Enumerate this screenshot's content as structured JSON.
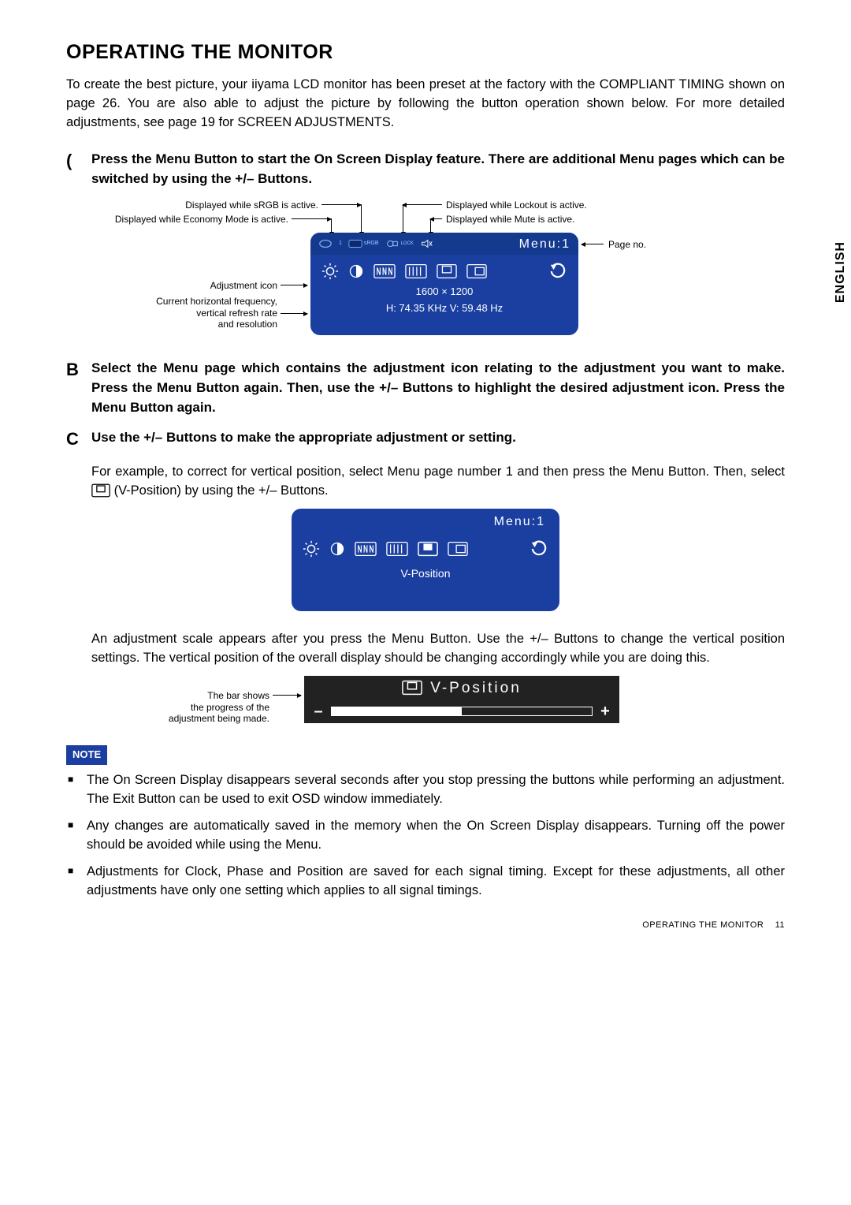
{
  "title": "OPERATING THE MONITOR",
  "intro": "To create the best picture, your iiyama LCD monitor has been preset at the factory with the COMPLIANT TIMING shown on page 26. You are also able to adjust the picture by following the button operation shown below. For more detailed adjustments, see page 19 for SCREEN ADJUSTMENTS.",
  "language_tab": "ENGLISH",
  "step_a": {
    "marker": "(",
    "text": "Press the Menu Button to start the On Screen Display feature. There are additional Menu pages which can be switched by using the +/– Buttons."
  },
  "diagram1": {
    "callouts": {
      "srgb": "Displayed while sRGB is active.",
      "economy": "Displayed while Economy Mode is active.",
      "lockout": "Displayed while Lockout is active.",
      "mute": "Displayed while Mute is active.",
      "pageno": "Page no.",
      "adj_icon": "Adjustment icon",
      "freq_line1": "Current horizontal frequency,",
      "freq_line2": "vertical refresh rate",
      "freq_line3": "and resolution"
    },
    "osd": {
      "menu_label": "Menu:1",
      "srgb_badge": "sRGB",
      "lock_badge": "LOCK",
      "economy_badge": "1",
      "resolution": "1600 × 1200",
      "frequency": "H: 74.35 KHz  V: 59.48 Hz"
    }
  },
  "step_b": {
    "marker": "B",
    "text": "Select the Menu page which contains the adjustment icon relating to the adjustment you want to make. Press the Menu Button again. Then, use the +/– Buttons to highlight the desired adjustment icon. Press the Menu Button again."
  },
  "step_c": {
    "marker": "C",
    "text": "Use the +/– Buttons to make the appropriate adjustment or setting.",
    "body_pre": "For example, to correct for vertical position, select Menu page number 1 and then press the Menu Button. Then, select ",
    "body_post": " (V-Position) by using the +/– Buttons."
  },
  "osd2": {
    "menu_label": "Menu:1",
    "selected_label": "V-Position"
  },
  "after_osd2": "An adjustment scale appears after you press the Menu Button. Use the +/– Buttons to change the vertical position settings. The vertical position of the overall display should be changing accordingly while you are doing this.",
  "adjbar": {
    "title": "V-Position",
    "minus": "–",
    "plus": "+",
    "callout_line1": "The bar shows",
    "callout_line2": "the progress of the",
    "callout_line3": "adjustment being made."
  },
  "note_label": "NOTE",
  "notes": [
    "The On Screen Display disappears several seconds after you stop pressing the buttons while performing an adjustment. The Exit Button can be used to exit OSD window immediately.",
    "Any changes are automatically saved in the memory when the On Screen Display disappears. Turning off the power should be avoided while using the Menu.",
    "Adjustments for Clock, Phase and Position are saved for each signal timing. Except for these adjustments, all other adjustments have only one setting which applies to all signal timings."
  ],
  "footer": {
    "section": "OPERATING THE MONITOR",
    "page": "11"
  }
}
